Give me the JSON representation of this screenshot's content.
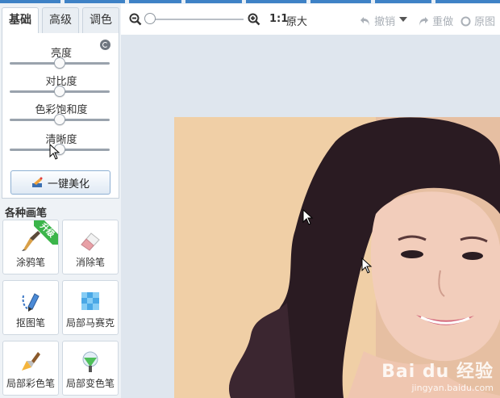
{
  "tabs": [
    {
      "label": "基础",
      "active": true
    },
    {
      "label": "高级",
      "active": false
    },
    {
      "label": "调色",
      "active": false
    }
  ],
  "adjust": {
    "sliders": [
      {
        "label": "亮度",
        "value": 0.5
      },
      {
        "label": "对比度",
        "value": 0.5
      },
      {
        "label": "色彩饱和度",
        "value": 0.5
      },
      {
        "label": "清晰度",
        "value": 0.5
      }
    ],
    "beautify_label": "一键美化"
  },
  "brushes": {
    "title": "各种画笔",
    "badge": "升级",
    "items": [
      {
        "label": "涂鸦笔",
        "icon": "brush-icon"
      },
      {
        "label": "消除笔",
        "icon": "eraser-icon"
      },
      {
        "label": "抠图笔",
        "icon": "cutout-pen-icon"
      },
      {
        "label": "局部马赛克",
        "icon": "mosaic-icon"
      },
      {
        "label": "局部彩色笔",
        "icon": "color-brush-icon"
      },
      {
        "label": "局部变色笔",
        "icon": "recolor-brush-icon"
      }
    ]
  },
  "toolbar": {
    "zoom_ratio": "1:1",
    "original_size": "原大",
    "undo": "撤销",
    "redo": "重做",
    "original": "原图"
  },
  "watermark": {
    "brand": "Bai du 经验",
    "url": "jingyan.baidu.com"
  },
  "colors": {
    "accent": "#3e82c6",
    "badge": "#3bb54a",
    "panel_bg": "#eef2f6"
  }
}
